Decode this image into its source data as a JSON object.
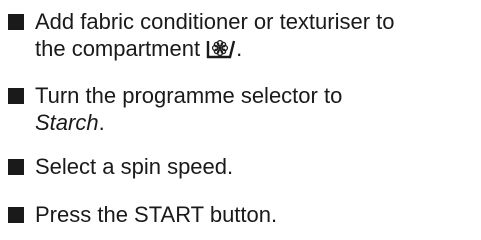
{
  "instructions": {
    "item1": {
      "line1": "Add fabric conditioner or texturiser to",
      "line2": "the compartment",
      "after_icon": ".",
      "icon": "fabric-conditioner-compartment-icon"
    },
    "item2": {
      "line1": "Turn the programme selector to",
      "programme": "Starch",
      "after": "."
    },
    "item3": {
      "text": "Select a spin speed."
    },
    "item4": {
      "text": "Press the START button."
    }
  },
  "colors": {
    "text": "#1a1a1a",
    "background": "#ffffff"
  }
}
